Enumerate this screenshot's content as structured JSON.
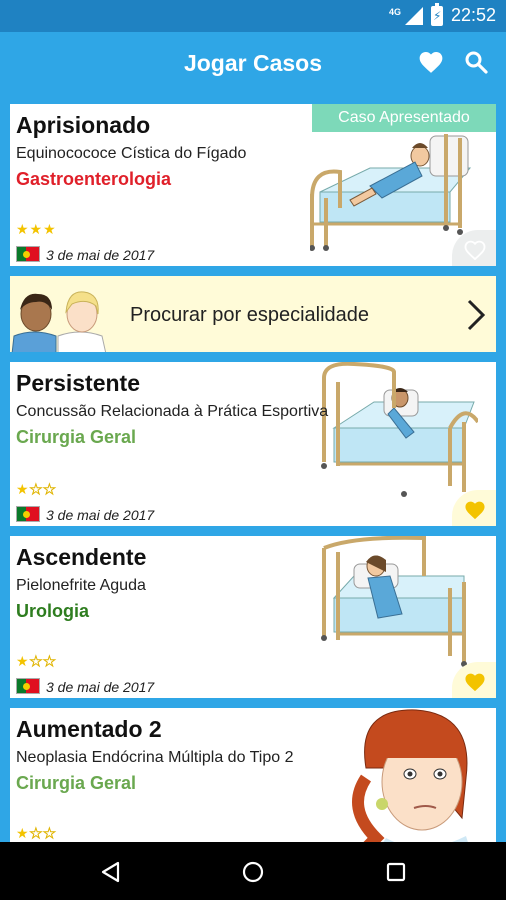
{
  "status_bar": {
    "network": "4G",
    "battery_icon": "battery-charging-icon",
    "time": "22:52"
  },
  "app_bar": {
    "title": "Jogar Casos",
    "icons": [
      "heart-icon",
      "search-icon"
    ]
  },
  "colors": {
    "primary": "#2fa6e6",
    "status_bar": "#1f82c2",
    "featured_badge": "#7dd9b9",
    "banner_bg": "#fffbd8",
    "star": "#f3c300",
    "favorite_on": "#f3c300"
  },
  "cases": [
    {
      "title": "Aprisionado",
      "condition": "Equinocococe Cística do Fígado",
      "specialty": "Gastroenterologia",
      "specialty_color": "#e0202a",
      "rating": 3,
      "max_rating": 5,
      "stars_text": "★★★",
      "date": "3 de mai de 2017",
      "badge": "Caso Apresentado",
      "favorited": false,
      "illustration": "patient-in-bed"
    },
    {
      "title": "Persistente",
      "condition": "Concussão Relacionada à Prática Esportiva",
      "specialty": "Cirurgia Geral",
      "specialty_color": "#6aa84f",
      "rating": 1,
      "max_rating": 3,
      "stars_on": "★",
      "stars_off": "★★",
      "date": "3 de mai de 2017",
      "favorited": true,
      "illustration": "patient-in-bed"
    },
    {
      "title": "Ascendente",
      "condition": "Pielonefrite Aguda",
      "specialty": "Urologia",
      "specialty_color": "#2e7d1f",
      "rating": 1,
      "max_rating": 3,
      "stars_on": "★",
      "stars_off": "★★",
      "date": "3 de mai de 2017",
      "favorited": true,
      "illustration": "patient-in-bed"
    },
    {
      "title": "Aumentado 2",
      "condition": "Neoplasia Endócrina Múltipla do Tipo 2",
      "specialty": "Cirurgia Geral",
      "specialty_color": "#6aa84f",
      "rating": 1,
      "max_rating": 3,
      "stars_on": "★",
      "stars_off": "★★",
      "illustration": "patient-portrait"
    }
  ],
  "banner": {
    "text": "Procurar por especialidade",
    "icon": "chevron-right-icon"
  },
  "nav_bar": {
    "icons": [
      "back-icon",
      "home-icon",
      "recents-icon"
    ]
  }
}
